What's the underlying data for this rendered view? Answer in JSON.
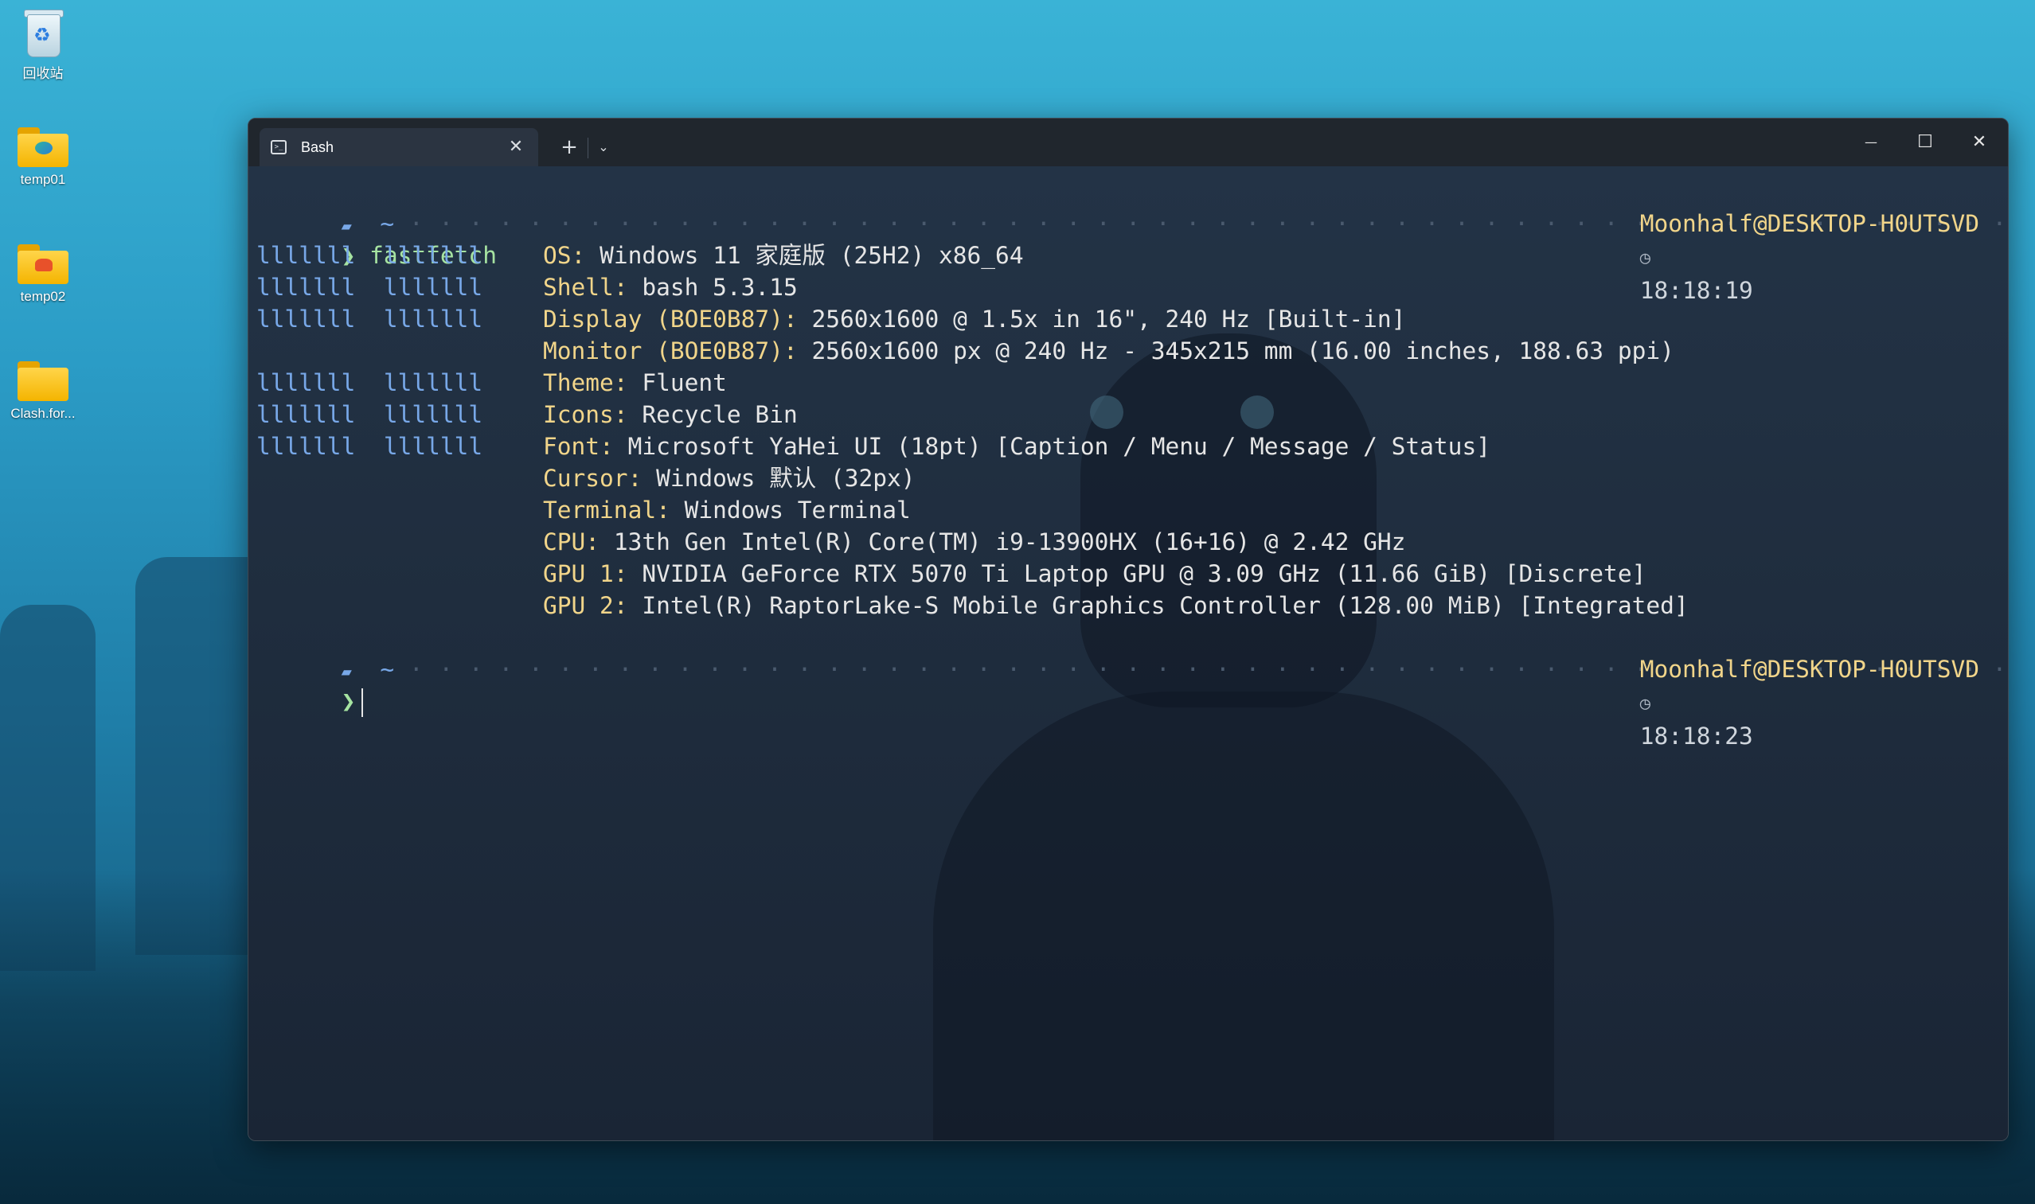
{
  "desktop": {
    "icons": [
      {
        "label": "回收站",
        "icon": "recycle-bin-icon"
      },
      {
        "label": "temp01",
        "icon": "folder-icon"
      },
      {
        "label": "temp02",
        "icon": "folder-icon"
      },
      {
        "label": "Clash.for...",
        "icon": "folder-icon"
      }
    ]
  },
  "window": {
    "tab_label": "Bash",
    "new_tab_symbol": "+",
    "dropdown_symbol": "⌄",
    "minimize_symbol": "—",
    "maximize_symbol": "☐",
    "close_symbol": "✕",
    "tab_close_symbol": "✕"
  },
  "terminal": {
    "prompt1": {
      "dir": "~",
      "user_host": "Moonhalf@DESKTOP-H0UTSVD",
      "time": "18:18:19"
    },
    "command": "fastfetch",
    "prompt_arrow": "❯",
    "logo_block": "lllllll  lllllll",
    "info": [
      {
        "key": "OS",
        "value": "Windows 11 家庭版 (25H2) x86_64"
      },
      {
        "key": "Shell",
        "value": "bash 5.3.15"
      },
      {
        "key": "Display (BOE0B87)",
        "value": "2560x1600 @ 1.5x in 16\", 240 Hz [Built-in]"
      },
      {
        "key": "Monitor (BOE0B87)",
        "value": "2560x1600 px @ 240 Hz - 345x215 mm (16.00 inches, 188.63 ppi)"
      },
      {
        "key": "Theme",
        "value": "Fluent"
      },
      {
        "key": "Icons",
        "value": "Recycle Bin"
      },
      {
        "key": "Font",
        "value": "Microsoft YaHei UI (18pt) [Caption / Menu / Message / Status]"
      },
      {
        "key": "Cursor",
        "value": "Windows 默认 (32px)"
      },
      {
        "key": "Terminal",
        "value": "Windows Terminal"
      },
      {
        "key": "CPU",
        "value": "13th Gen Intel(R) Core(TM) i9-13900HX (16+16) @ 2.42 GHz"
      },
      {
        "key": "GPU 1",
        "value": "NVIDIA GeForce RTX 5070 Ti Laptop GPU @ 3.09 GHz (11.66 GiB) [Discrete]"
      },
      {
        "key": "GPU 2",
        "value": "Intel(R) RaptorLake-S Mobile Graphics Controller (128.00 MiB) [Integrated]"
      }
    ],
    "prompt2": {
      "dir": "~",
      "user_host": "Moonhalf@DESKTOP-H0UTSVD",
      "time": "18:18:23"
    }
  }
}
